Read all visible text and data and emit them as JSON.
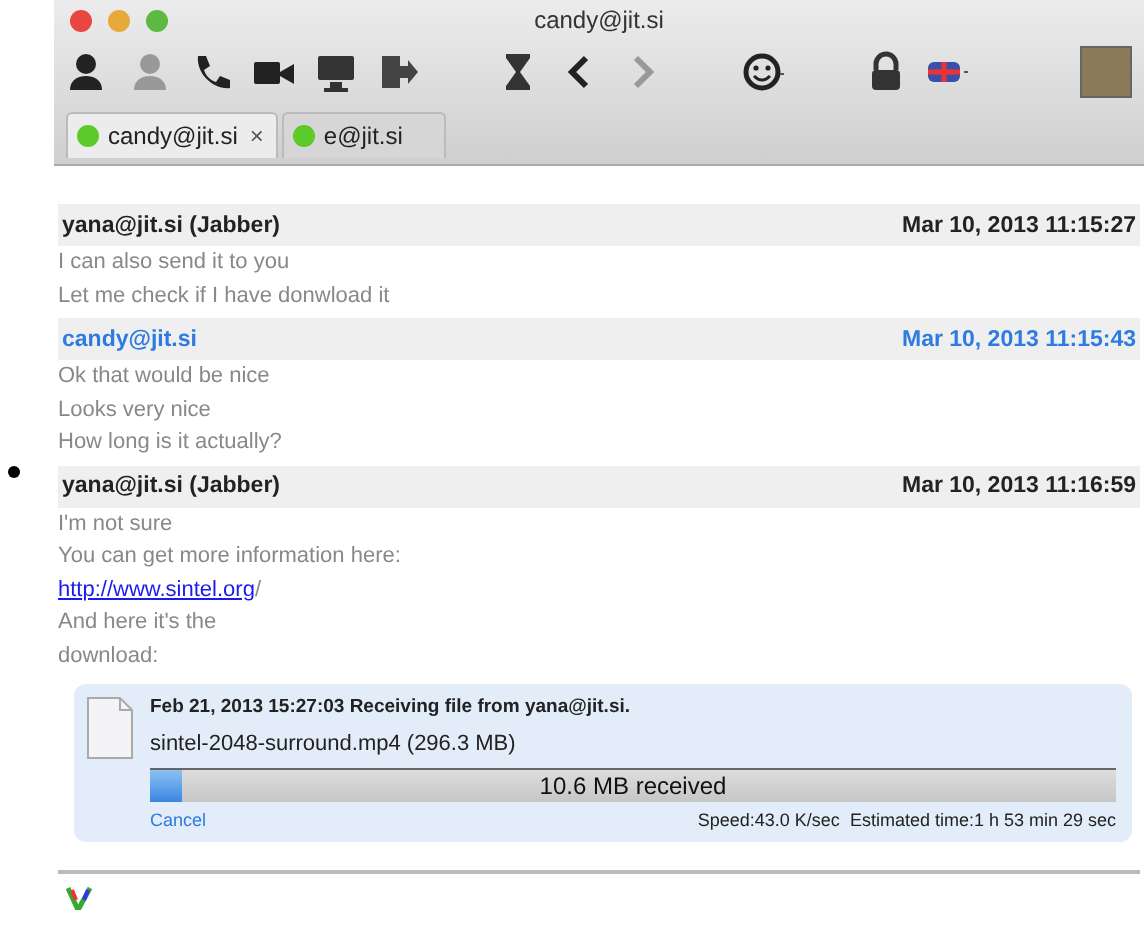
{
  "window": {
    "title": "candy@jit.si"
  },
  "tabs": [
    {
      "label": "candy@jit.si",
      "selected": true,
      "close": "×"
    },
    {
      "label": "e@jit.si",
      "selected": false
    }
  ],
  "messages": [
    {
      "sender": "yana@jit.si (Jabber)",
      "time": "Mar 10, 2013 11:15:27",
      "own": false,
      "lines": [
        {
          "kind": "text",
          "text": "I can also send it to you"
        },
        {
          "kind": "text",
          "text": "Let me check if I have donwload it"
        }
      ]
    },
    {
      "sender": "candy@jit.si",
      "time": "Mar 10, 2013 11:15:43",
      "own": true,
      "lines": [
        {
          "kind": "text",
          "text": "Ok that would be nice"
        },
        {
          "kind": "text",
          "text": "Looks very nice"
        },
        {
          "kind": "text",
          "text": "How long is it actually?"
        }
      ]
    },
    {
      "sender": "yana@jit.si (Jabber)",
      "time": "Mar 10, 2013 11:16:59",
      "own": false,
      "lines": [
        {
          "kind": "text",
          "text": "I'm not sure"
        },
        {
          "kind": "text",
          "text": "You can get more information here:"
        },
        {
          "kind": "link",
          "text": "http://www.sintel.org",
          "suffix": "/"
        },
        {
          "kind": "text",
          "text": "And here it's the"
        },
        {
          "kind": "text",
          "text": "download:"
        }
      ]
    }
  ],
  "file_transfer": {
    "title": "Feb 21, 2013 15:27:03 Receiving file from yana@jit.si.",
    "file": "sintel-2048-surround.mp4 (296.3 MB)",
    "level": 0.034,
    "progress_text": "10.6 MB received",
    "cancel": "Cancel",
    "speed": "Speed:43.0 K/sec",
    "estimate": "Estimated time:1 h 53 min 29 sec"
  }
}
